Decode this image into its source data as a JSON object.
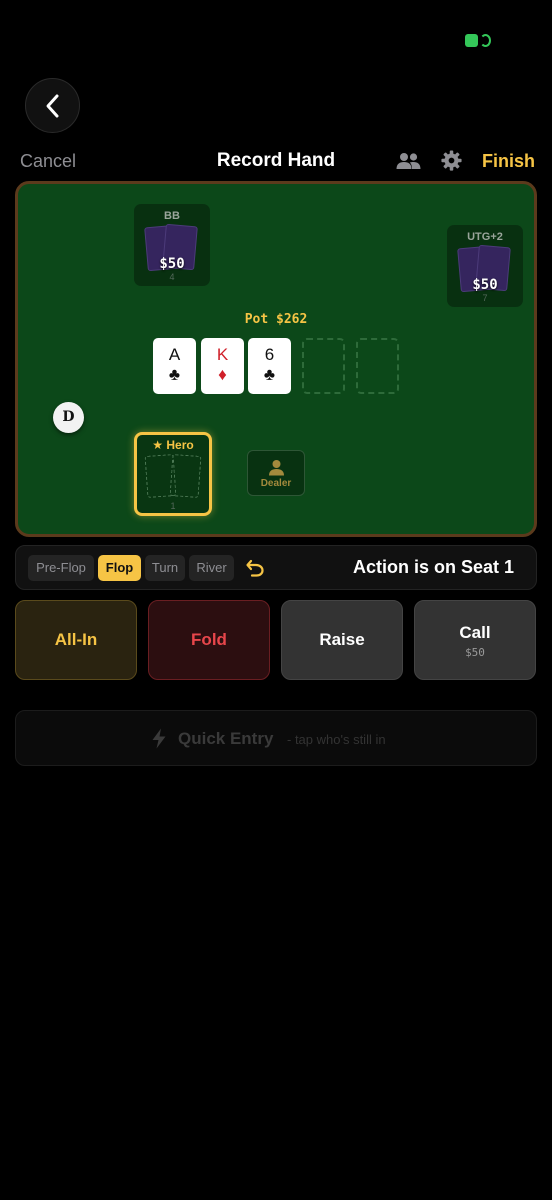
{
  "colors": {
    "accent": "#f6c445",
    "felt": "#0c4819",
    "rail": "#5c3a1c",
    "fold": "#e8464b",
    "battery": "#34c759"
  },
  "icons": {
    "back": "chevron-left-icon",
    "players": "people-icon",
    "settings": "gear-icon",
    "undo": "undo-arrow-icon",
    "quick_entry": "lightning-icon",
    "dealer_seat": "person-icon",
    "hero": "star-icon"
  },
  "header": {
    "cancel_label": "Cancel",
    "title": "Record Hand",
    "finish_label": "Finish"
  },
  "table": {
    "pot_label": "Pot $262",
    "seats": [
      {
        "name": "BB",
        "stack": "$50",
        "seat_number": "4"
      },
      {
        "name": "UTG+2",
        "stack": "$50",
        "seat_number": "7"
      }
    ],
    "board": [
      {
        "rank": "A",
        "suit": "♣",
        "color": "#111111"
      },
      {
        "rank": "K",
        "suit": "♦",
        "color": "#d0202a"
      },
      {
        "rank": "6",
        "suit": "♣",
        "color": "#111111"
      }
    ],
    "empty_board_slots": 2,
    "dealer_button": "D",
    "hero": {
      "label": "★ Hero",
      "seat_number": "1"
    },
    "dealer_seat_label": "Dealer"
  },
  "action_bar": {
    "streets": [
      {
        "label": "Pre-Flop",
        "active": false
      },
      {
        "label": "Flop",
        "active": true
      },
      {
        "label": "Turn",
        "active": false
      },
      {
        "label": "River",
        "active": false
      }
    ],
    "status": "Action is on Seat 1"
  },
  "actions": {
    "all_in": "All-In",
    "fold": "Fold",
    "raise": "Raise",
    "call": "Call",
    "call_amount": "$50"
  },
  "quick_entry": {
    "label": "Quick Entry",
    "hint": "- tap who's still in"
  }
}
